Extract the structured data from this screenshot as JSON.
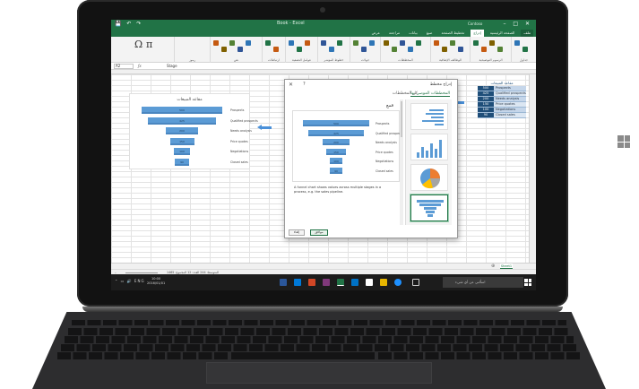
{
  "window": {
    "title": "Book - Excel",
    "user": "Contoso"
  },
  "ribbon_tabs": [
    "ملف",
    "الصفحة الرئيسية",
    "إدراج",
    "تخطيط الصفحة",
    "صيغ",
    "بيانات",
    "مراجعة",
    "عرض"
  ],
  "ribbon_groups": [
    "جداول",
    "الرسوم التوضيحية",
    "الوظائف الإضافية",
    "المخططات",
    "جولات",
    "خطوط المؤشر",
    "عوامل التصفية",
    "ارتباطات",
    "نص",
    "رموز"
  ],
  "formula_bar": {
    "name_box": "A2",
    "value": "Stage"
  },
  "table": {
    "title": "مقاعد المبيعات",
    "rows": [
      {
        "value": "500",
        "label": "Prospects"
      },
      {
        "value": "425",
        "label": "Qualified prospects"
      },
      {
        "value": "200",
        "label": "Needs analysis"
      },
      {
        "value": "150",
        "label": "Price quotes"
      },
      {
        "value": "100",
        "label": "Negotiations"
      },
      {
        "value": "90",
        "label": "Closed sales"
      }
    ]
  },
  "chart_data": {
    "type": "bar",
    "title": "مقاعد المبيعات",
    "categories": [
      "Prospects",
      "Qualified prospects",
      "Needs analysis",
      "Price quotes",
      "Negotiations",
      "Closed sales"
    ],
    "values": [
      500,
      425,
      200,
      150,
      100,
      90
    ],
    "xlabel": "",
    "ylabel": "",
    "grid": false,
    "legend": "none"
  },
  "dialog": {
    "title": "إدراج مخطط",
    "tab_recommended": "المخططات الموصى بها",
    "tab_all": "كل المخططات",
    "preview_title": "قمع",
    "description": "A funnel chart shows values across multiple stages in a process, e.g. the sales pipeline.",
    "ok_label": "موافق",
    "cancel_label": "إلغاء"
  },
  "sheet_tab": "Sheet1",
  "status_text": "المتوسط: 244  العدد: 12  المجموع: 1465",
  "taskbar": {
    "search_placeholder": "اسألني عن أي شيء",
    "time": "10:00",
    "date": "2016/01/01"
  },
  "colors": {
    "excel_green": "#217346",
    "funnel_blue": "#5b9bd5",
    "table_navy": "#1f4e79"
  }
}
